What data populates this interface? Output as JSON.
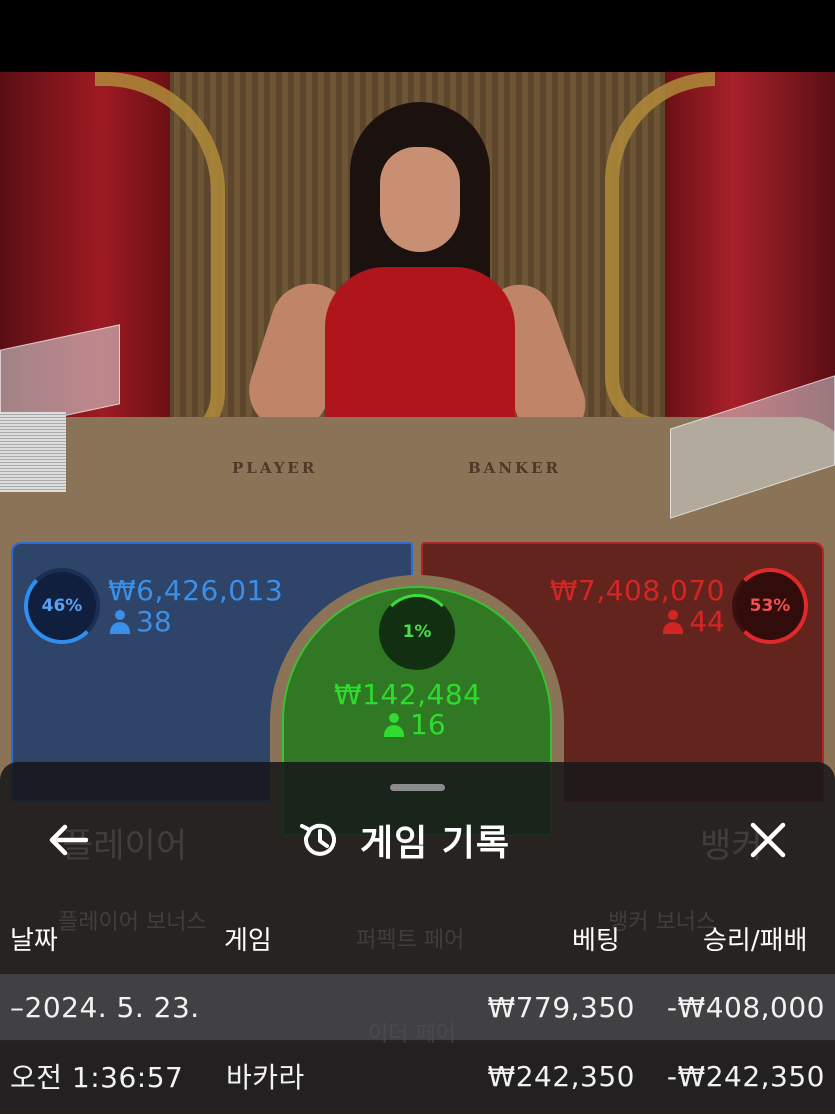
{
  "table": {
    "player_label": "PLAYER",
    "banker_label": "BANKER"
  },
  "bets": {
    "player": {
      "percent": "46%",
      "amount": "₩6,426,013",
      "players": "38",
      "color": "#3a8fe8"
    },
    "banker": {
      "percent": "53%",
      "amount": "₩7,408,070",
      "players": "44",
      "color": "#d42525"
    },
    "tie": {
      "percent": "1%",
      "amount": "₩142,484",
      "players": "16",
      "color": "#2edb2e"
    }
  },
  "background_labels": {
    "player": "플레이어",
    "banker": "뱅커",
    "player_bonus": "플레이어 보너스",
    "perfect_pair": "퍼펙트 페어",
    "either_pair": "이더 페어",
    "banker_bonus": "뱅커 보너스"
  },
  "history": {
    "title": "게임 기록",
    "icons": {
      "back": "arrow-left-icon",
      "history": "history-clock-icon",
      "close": "close-icon"
    },
    "columns": {
      "date": "날짜",
      "game": "게임",
      "bet": "베팅",
      "winloss": "승리/패배"
    },
    "date_row": {
      "date": "–2024. 5. 23.",
      "bet": "₩779,350",
      "winloss": "-₩408,000"
    },
    "rows": [
      {
        "time": "오전 1:36:57",
        "game": "바카라",
        "bet": "₩242,350",
        "winloss": "-₩242,350"
      }
    ]
  }
}
